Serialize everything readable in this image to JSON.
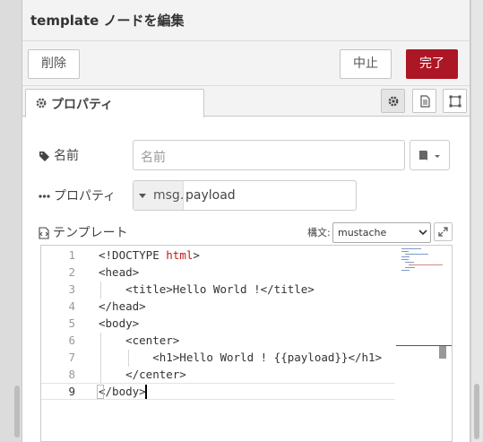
{
  "tray": {
    "title": "template ノードを編集"
  },
  "toolbar": {
    "delete_label": "削除",
    "cancel_label": "中止",
    "done_label": "完了",
    "done_color": "#ad1625"
  },
  "tabs": {
    "properties_label": "プロパティ"
  },
  "form": {
    "name_label": "名前",
    "name_placeholder": "名前",
    "property_label": "プロパティ",
    "property_type": "msg.",
    "property_value": "payload",
    "template_label": "テンプレート",
    "syntax_label": "構文:",
    "syntax_value": "mustache"
  },
  "editor": {
    "lines": [
      {
        "num": "1",
        "a": "<!DOCTYPE ",
        "b": "html",
        "c": ">"
      },
      {
        "num": "2",
        "a": "<head>",
        "b": "",
        "c": ""
      },
      {
        "num": "3",
        "a": "    <title>Hello World !</title>",
        "b": "",
        "c": ""
      },
      {
        "num": "4",
        "a": "</head>",
        "b": "",
        "c": ""
      },
      {
        "num": "5",
        "a": "<body>",
        "b": "",
        "c": ""
      },
      {
        "num": "6",
        "a": "    <center>",
        "b": "",
        "c": ""
      },
      {
        "num": "7",
        "a": "        <h1>Hello World ! {{payload}}</h1>",
        "b": "",
        "c": ""
      },
      {
        "num": "8",
        "a": "    </center>",
        "b": "",
        "c": ""
      },
      {
        "num": "9",
        "a": "</body>",
        "b": "",
        "c": ""
      }
    ]
  }
}
